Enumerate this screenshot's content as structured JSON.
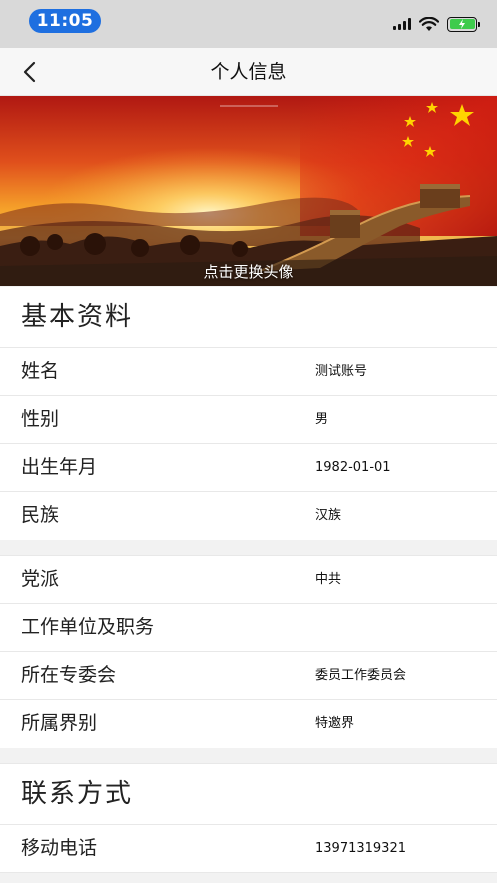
{
  "status_bar": {
    "time": "11:05"
  },
  "nav": {
    "title": "个人信息"
  },
  "banner": {
    "caption": "点击更换头像"
  },
  "basic": {
    "title": "基本资料",
    "rows": [
      {
        "label": "姓名",
        "value": "测试账号"
      },
      {
        "label": "性别",
        "value": "男"
      },
      {
        "label": "出生年月",
        "value": "1982-01-01"
      },
      {
        "label": "民族",
        "value": "汉族"
      }
    ]
  },
  "work": {
    "rows": [
      {
        "label": "党派",
        "value": "中共"
      },
      {
        "label": "工作单位及职务",
        "value": ""
      },
      {
        "label": "所在专委会",
        "value": "委员工作委员会"
      },
      {
        "label": "所属界别",
        "value": "特邀界"
      }
    ]
  },
  "contact": {
    "title": "联系方式",
    "rows": [
      {
        "label": "移动电话",
        "value": "13971319321"
      }
    ]
  },
  "icons": [
    "back-chevron-icon",
    "signal-icon",
    "wifi-icon",
    "battery-icon"
  ],
  "colors": {
    "status_pill": "#1e6fe0",
    "battery": "#3ecb4c",
    "background": "#f2f2f2"
  }
}
